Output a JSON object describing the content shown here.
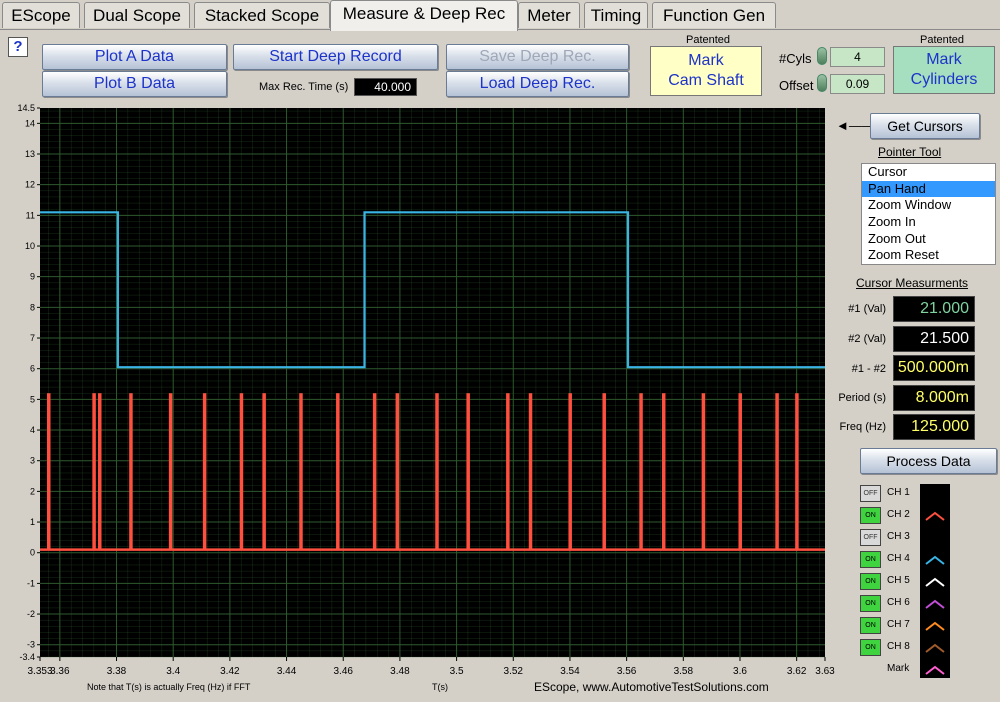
{
  "tabs": [
    "EScope",
    "Dual Scope",
    "Stacked Scope",
    "Measure & Deep Rec",
    "Meter",
    "Timing",
    "Function Gen"
  ],
  "active_tab": "Measure & Deep Rec",
  "help_label": "?",
  "toolbar": {
    "plot_a": "Plot A Data",
    "plot_b": "Plot B Data",
    "start_deep": "Start Deep Record",
    "save_deep": "Save Deep Rec.",
    "load_deep": "Load Deep Rec.",
    "max_rec_label": "Max Rec. Time (s)",
    "max_rec_value": "40.000",
    "patented_1": "Patented",
    "mark_cam_line1": "Mark",
    "mark_cam_line2": "Cam Shaft",
    "cyls_label": "#Cyls",
    "cyls_value": "4",
    "offset_label": "Offset",
    "offset_value": "0.09",
    "patented_2": "Patented",
    "mark_cyl_line1": "Mark",
    "mark_cyl_line2": "Cylinders"
  },
  "side": {
    "arrow": "◄——",
    "get_cursors": "Get Cursors",
    "pointer_tool_label": "Pointer Tool",
    "pointer_items": [
      "Cursor",
      "Pan Hand",
      "Zoom Window",
      "Zoom In",
      "Zoom Out",
      "Zoom Reset"
    ],
    "pointer_selected": "Pan Hand",
    "cursor_label": "Cursor Measurments",
    "measurements": [
      {
        "label": "#1 (Val)",
        "value": "21.000",
        "color": "#7fd39f"
      },
      {
        "label": "#2 (Val)",
        "value": "21.500",
        "color": "#ffffff"
      },
      {
        "label": "#1 - #2",
        "value": "500.000m",
        "color": "#ffff66"
      },
      {
        "label": "Period (s)",
        "value": "8.000m",
        "color": "#ffff66"
      },
      {
        "label": "Freq (Hz)",
        "value": "125.000",
        "color": "#ffff66"
      }
    ],
    "process_data": "Process Data",
    "channels": [
      {
        "label": "CH 1",
        "state": "OFF",
        "color": "#000000"
      },
      {
        "label": "CH 2",
        "state": "ON",
        "color": "#ff4f3f"
      },
      {
        "label": "CH 3",
        "state": "OFF",
        "color": "#000000"
      },
      {
        "label": "CH 4",
        "state": "ON",
        "color": "#39b4e5"
      },
      {
        "label": "CH 5",
        "state": "ON",
        "color": "#ffffff"
      },
      {
        "label": "CH 6",
        "state": "ON",
        "color": "#c24fd8"
      },
      {
        "label": "CH 7",
        "state": "ON",
        "color": "#ff8a1f"
      },
      {
        "label": "CH 8",
        "state": "ON",
        "color": "#a05a2c"
      },
      {
        "label": "Mark",
        "state": "",
        "color": "#ff5fd0"
      }
    ]
  },
  "footer": {
    "note": "Note that T(s) is actually Freq (Hz) if FFT",
    "xlabel": "T(s)",
    "site": "EScope, www.AutomotiveTestSolutions.com"
  },
  "chart_data": {
    "type": "line",
    "xlabel": "T(s)",
    "ylabel": "",
    "xlim": [
      3.353,
      3.63
    ],
    "ylim": [
      -3.4,
      14.5
    ],
    "x_ticks": [
      "3.353",
      "3.36",
      "3.38",
      "3.4",
      "3.42",
      "3.44",
      "3.46",
      "3.48",
      "3.5",
      "3.52",
      "3.54",
      "3.56",
      "3.58",
      "3.6",
      "3.62",
      "3.63"
    ],
    "y_ticks": [
      "-3.4",
      "-3",
      "-2",
      "-1",
      "0",
      "1",
      "2",
      "3",
      "4",
      "5",
      "6",
      "7",
      "8",
      "9",
      "10",
      "11",
      "12",
      "13",
      "14",
      "14.5"
    ],
    "grid": true,
    "background": "#000000",
    "grid_color": "#2e5a2e",
    "series": [
      {
        "name": "CH 4",
        "color": "#39b4e5",
        "x": [
          3.353,
          3.3805,
          3.3805,
          3.4675,
          3.4675,
          3.5605,
          3.5605,
          3.63
        ],
        "y": [
          11.1,
          11.1,
          6.05,
          6.05,
          11.1,
          11.1,
          6.05,
          6.05
        ]
      },
      {
        "name": "CH 2",
        "color": "#ff4f3f",
        "baseline": 0.1,
        "peak": 5.2,
        "pulse_x": [
          3.356,
          3.372,
          3.374,
          3.385,
          3.399,
          3.411,
          3.424,
          3.432,
          3.445,
          3.458,
          3.471,
          3.479,
          3.493,
          3.504,
          3.518,
          3.526,
          3.54,
          3.552,
          3.565,
          3.573,
          3.587,
          3.6,
          3.613,
          3.62
        ]
      }
    ]
  }
}
